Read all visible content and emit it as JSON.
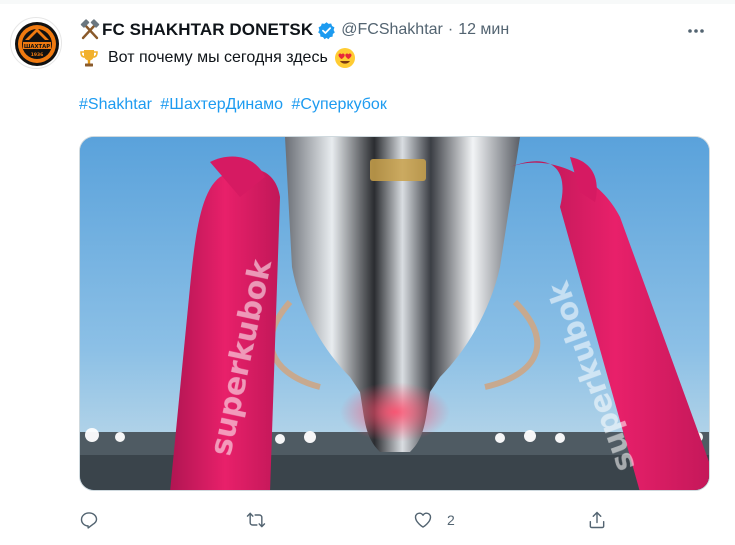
{
  "tweet": {
    "author_name": "FC SHAKHTAR DONETSK",
    "handle": "@FCShakhtar",
    "separator": "·",
    "time_ago": "12 мин",
    "text": "Вот почему мы сегодня здесь",
    "hashtags": [
      "#Shakhtar",
      "#ШахтерДинамо",
      "#Суперкубок"
    ],
    "avatar_text": "ШАХТАР",
    "avatar_year": "1936",
    "name_prefix_icon": "crossed-hammers-icon",
    "text_prefix_icon": "trophy-icon",
    "text_suffix_icon": "smiling-face-with-heart-eyes-icon",
    "media_description_icon": "super-cup-trophy-photo"
  },
  "actions": {
    "reply_count": "",
    "retweet_count": "",
    "like_count": "2",
    "share_count": ""
  },
  "colors": {
    "link": "#1d9bf0",
    "secondary_text": "#536471",
    "verified": "#1d9bf0",
    "ribbon": "#e8206a"
  }
}
